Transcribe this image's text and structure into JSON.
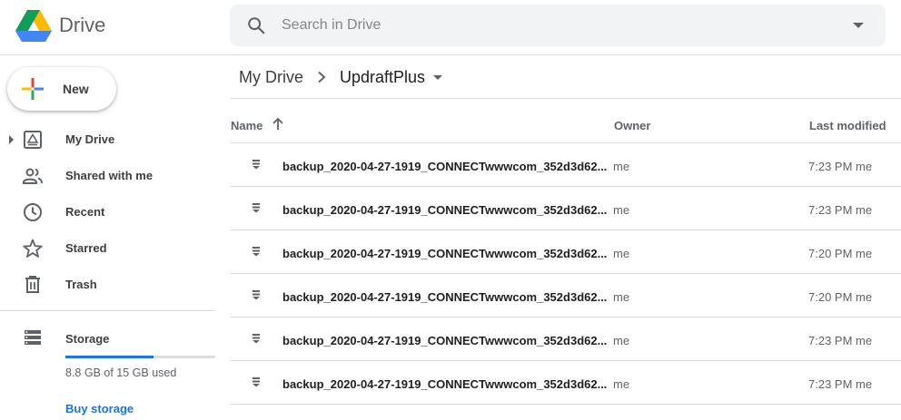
{
  "app": {
    "name": "Drive"
  },
  "search": {
    "placeholder": "Search in Drive"
  },
  "new_button": {
    "label": "New"
  },
  "sidebar": {
    "items": [
      {
        "label": "My Drive"
      },
      {
        "label": "Shared with me"
      },
      {
        "label": "Recent"
      },
      {
        "label": "Starred"
      },
      {
        "label": "Trash"
      }
    ],
    "storage": {
      "label": "Storage",
      "used_text": "8.8 GB of 15 GB used",
      "used_fraction": 0.59,
      "buy_label": "Buy storage"
    }
  },
  "breadcrumb": {
    "root": "My Drive",
    "current": "UpdraftPlus"
  },
  "table": {
    "headers": {
      "name": "Name",
      "owner": "Owner",
      "modified": "Last modified"
    },
    "rows": [
      {
        "name": "backup_2020-04-27-1919_CONNECTwwwcom_352d3d62...",
        "owner": "me",
        "modified": "7:23 PM",
        "by": "me"
      },
      {
        "name": "backup_2020-04-27-1919_CONNECTwwwcom_352d3d62...",
        "owner": "me",
        "modified": "7:23 PM",
        "by": "me"
      },
      {
        "name": "backup_2020-04-27-1919_CONNECTwwwcom_352d3d62...",
        "owner": "me",
        "modified": "7:20 PM",
        "by": "me"
      },
      {
        "name": "backup_2020-04-27-1919_CONNECTwwwcom_352d3d62...",
        "owner": "me",
        "modified": "7:20 PM",
        "by": "me"
      },
      {
        "name": "backup_2020-04-27-1919_CONNECTwwwcom_352d3d62...",
        "owner": "me",
        "modified": "7:23 PM",
        "by": "me"
      },
      {
        "name": "backup_2020-04-27-1919_CONNECTwwwcom_352d3d62...",
        "owner": "me",
        "modified": "7:23 PM",
        "by": "me"
      }
    ]
  },
  "colors": {
    "accent": "#1a73e8",
    "text": "#202124",
    "muted": "#5f6368",
    "divider": "#dadce0"
  },
  "icons": [
    "drive-logo-icon",
    "search-icon",
    "dropdown-icon",
    "plus-icon",
    "my-drive-icon",
    "shared-icon",
    "clock-icon",
    "star-icon",
    "trash-icon",
    "storage-icon",
    "chevron-right-icon",
    "arrow-up-icon",
    "file-icon"
  ]
}
